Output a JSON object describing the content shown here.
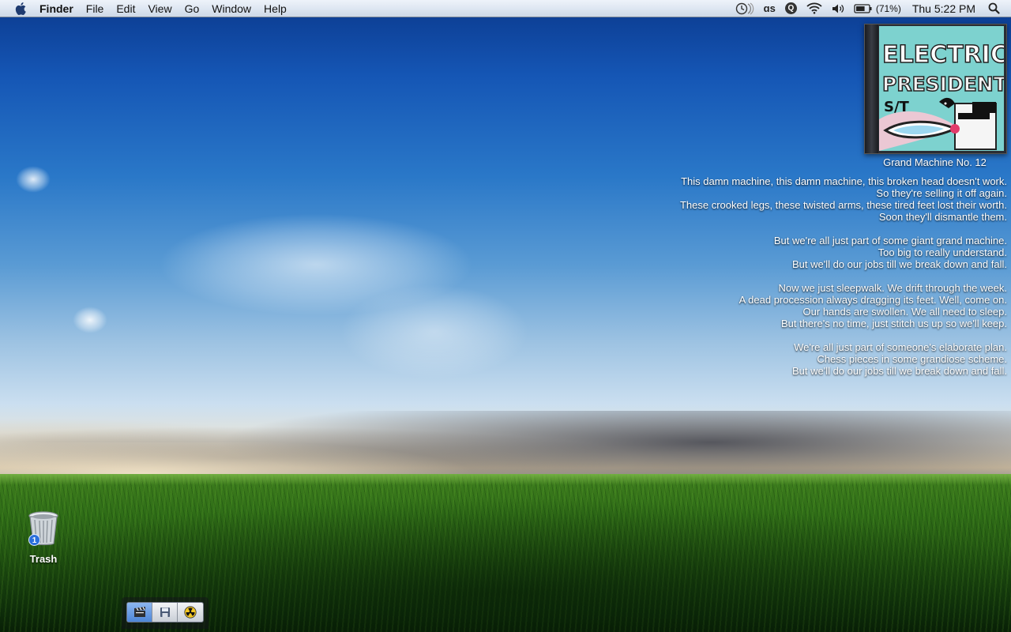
{
  "menubar": {
    "app_name": "Finder",
    "menus": [
      "File",
      "Edit",
      "View",
      "Go",
      "Window",
      "Help"
    ],
    "status_icons": [
      "time-machine-icon",
      "lastfm-icon",
      "quicksilver-icon",
      "wifi-icon",
      "volume-icon",
      "battery-icon",
      "spotlight-icon"
    ],
    "lastfm_label": "ɑs",
    "quicksilver_label": "Q",
    "battery_percent": "(71%)",
    "battery_level": 0.71,
    "clock": "Thu 5:22 PM"
  },
  "album": {
    "cover_text_line1": "ELECTRIC",
    "cover_text_line2": "PRESIDENT",
    "cover_text_line3": "S/T",
    "track_title": "Grand Machine No. 12"
  },
  "lyrics": {
    "stanzas": [
      [
        "This damn machine, this damn machine, this broken head doesn't work.",
        "So they're selling it off again.",
        "These crooked legs, these twisted arms, these tired feet lost their worth.",
        "Soon they'll dismantle them."
      ],
      [
        "But we're all just part of some giant grand machine.",
        "Too big to really understand.",
        "But we'll do our jobs till we break down and fall."
      ],
      [
        "Now we just sleepwalk. We drift through the week.",
        "A dead procession always dragging its feet. Well, come on.",
        "Our hands are swollen. We all need to sleep.",
        "But there's no time, just stitch us up so we'll keep."
      ],
      [
        "We're all just part of someone's elaborate plan.",
        "Chess pieces in some grandiose scheme.",
        "But we'll do our jobs till we break down and fall."
      ]
    ]
  },
  "desktop": {
    "trash_label": "Trash",
    "trash_badge": "1"
  },
  "dock": {
    "items": [
      "clapperboard-icon",
      "save-icon",
      "radiation-icon"
    ]
  },
  "colors": {
    "sky_top": "#0b3a8e",
    "grass": "#2f6d17",
    "menubar": "#dfe7f2",
    "badge": "#2b6fdc"
  }
}
